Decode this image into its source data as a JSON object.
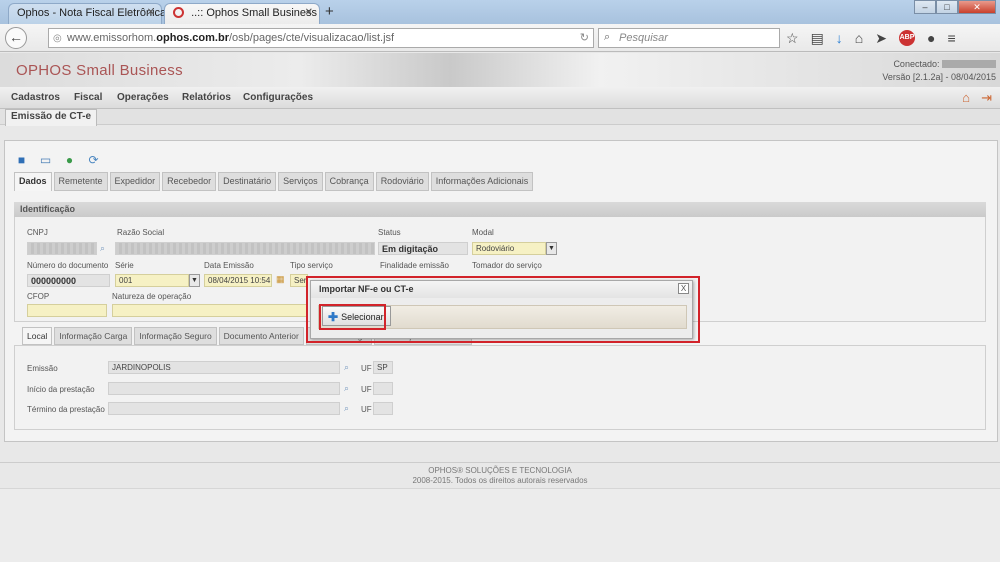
{
  "browser": {
    "tabs": [
      {
        "title": "Ophos - Nota Fiscal Eletrônica"
      },
      {
        "title": "..:: Ophos Small Business"
      }
    ],
    "url_prefix": "www.emissorhom.",
    "url_domain": "ophos.com.br",
    "url_path": "/osb/pages/cte/visualizacao/list.jsf",
    "search_placeholder": "Pesquisar",
    "abp_label": "ABP"
  },
  "app": {
    "logo": "OPHOS Small Business",
    "connected_label": "Conectado:",
    "version_line": "Versão [2.1.2a] - 08/04/2015",
    "menu": [
      "Cadastros",
      "Fiscal",
      "Operações",
      "Relatórios",
      "Configurações"
    ],
    "page_tab": "Emissão de CT-e"
  },
  "form": {
    "tabs": [
      "Dados",
      "Remetente",
      "Expedidor",
      "Recebedor",
      "Destinatário",
      "Serviços",
      "Cobrança",
      "Rodoviário",
      "Informações Adicionais"
    ],
    "section_title": "Identificação",
    "labels": {
      "cnpj": "CNPJ",
      "razao": "Razão Social",
      "status": "Status",
      "modal": "Modal",
      "numero": "Número do documento",
      "serie": "Série",
      "data": "Data Emissão",
      "tipo": "Tipo serviço",
      "finalidade": "Finalidade emissão",
      "tomador": "Tomador do serviço",
      "cfop": "CFOP",
      "natureza": "Natureza de operação"
    },
    "values": {
      "status": "Em digitação",
      "modal": "Rodoviário",
      "numero": "000000000",
      "serie": "001",
      "data": "08/04/2015 10:54",
      "tipo": "Serv"
    },
    "sub_tabs": [
      "Local",
      "Informação Carga",
      "Informação Seguro",
      "Documento Anterior",
      "Fluxo da carga",
      "Informações do veículo"
    ],
    "local": {
      "emissao_label": "Emissão",
      "emissao_value": "JARDINOPOLIS",
      "inicio_label": "Início da prestação",
      "termino_label": "Término da prestação",
      "uf_label": "UF",
      "uf_value": "SP"
    }
  },
  "modal": {
    "title": "Importar NF-e ou CT-e",
    "close": "X",
    "button": "Selecionar"
  },
  "footer": {
    "line1": "OPHOS® SOLUÇÕES E TECNOLOGIA",
    "line2": "2008-2015. Todos os direitos autorais reservados"
  },
  "colors": {
    "highlight": "#d2232a",
    "logo": "#aa5555",
    "yellow_field": "#f6f1c4"
  }
}
